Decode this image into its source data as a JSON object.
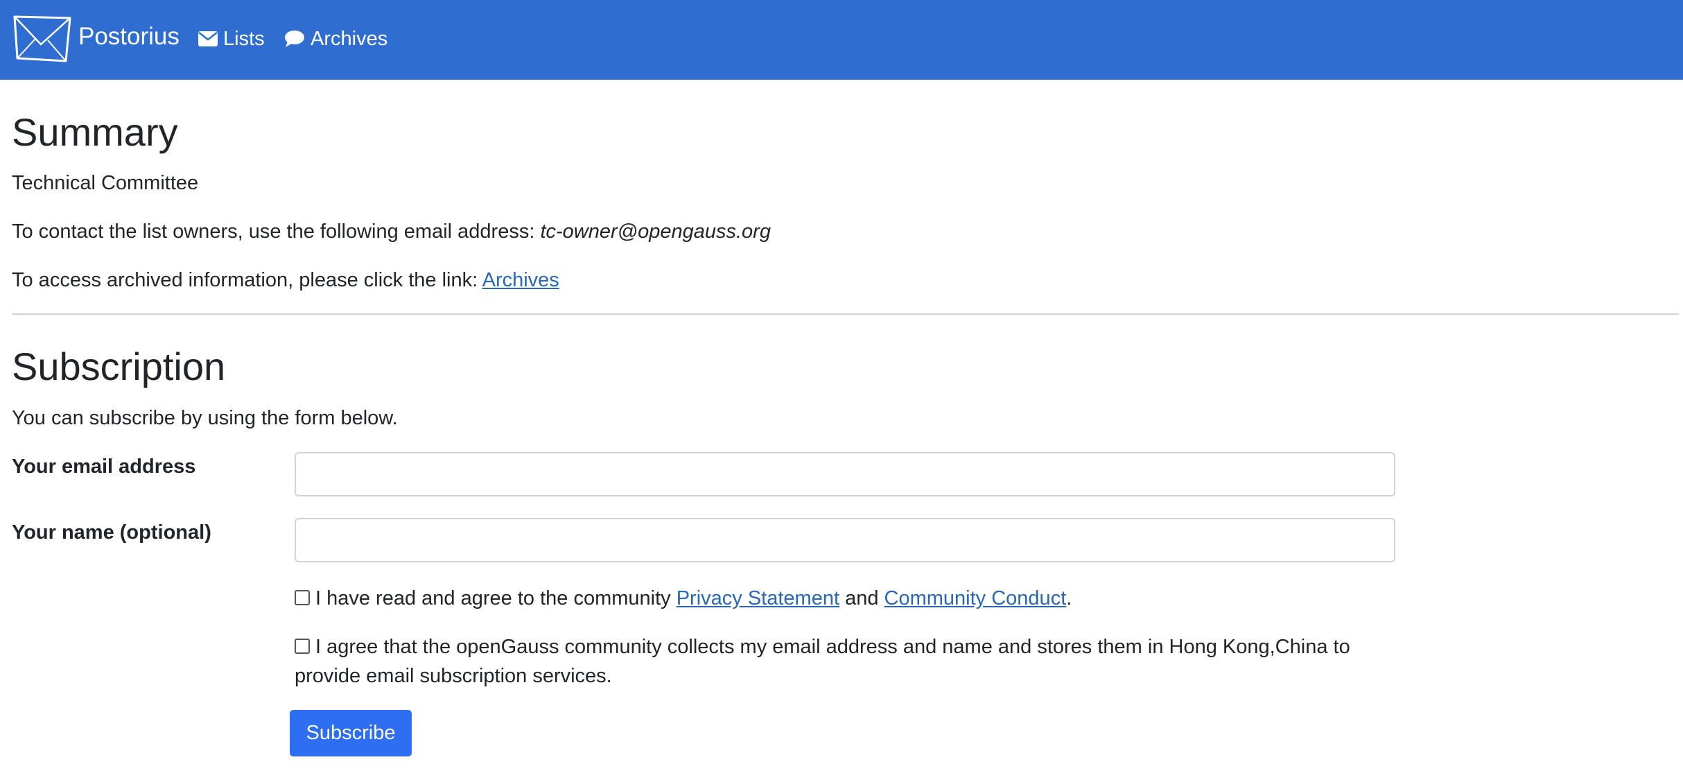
{
  "nav": {
    "brand": "Postorius",
    "lists": "Lists",
    "archives": "Archives"
  },
  "summary": {
    "heading": "Summary",
    "list_description": "Technical Committee",
    "contact_text": "To contact the list owners, use the following email address: ",
    "contact_email": "tc-owner@opengauss.org",
    "archive_text": "To access archived information, please click the link: ",
    "archive_link": "Archives"
  },
  "subscription": {
    "heading": "Subscription",
    "intro": "You can subscribe by using the form below.",
    "email_label": "Your email address",
    "email_value": "",
    "name_label": "Your name (optional)",
    "name_value": "",
    "privacy_text_before": "I have read and agree to the community ",
    "privacy_link": "Privacy Statement",
    "privacy_text_mid": " and ",
    "conduct_link": "Community Conduct",
    "privacy_text_after": ".",
    "consent_line1": "I agree that the openGauss community collects my email address and name and stores them in Hong Kong,China to",
    "consent_line2": "provide email subscription services.",
    "button_label": "Subscribe"
  },
  "colors": {
    "navbar": "#306dd1",
    "link": "#2a67b5",
    "button": "#2d6ef2"
  },
  "icons": {
    "brand": "envelope-logo-icon",
    "lists": "envelope-icon",
    "archives": "comment-icon"
  }
}
